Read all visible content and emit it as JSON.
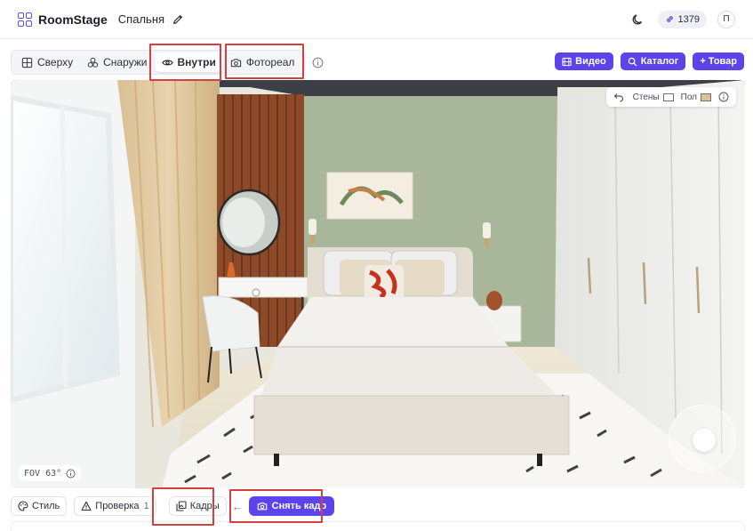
{
  "header": {
    "brand": "RoomStage",
    "room_name": "Спальня",
    "credits": "1379",
    "avatar_letter": "П"
  },
  "view_modes": {
    "tabs": [
      {
        "label": "Сверху",
        "icon": "grid-icon",
        "active": false
      },
      {
        "label": "Снаружи",
        "icon": "cubes-icon",
        "active": false
      },
      {
        "label": "Внутри",
        "icon": "eye-icon",
        "active": true
      },
      {
        "label": "Фотореал",
        "icon": "camera-icon",
        "active": false
      }
    ]
  },
  "actions": {
    "video_label": "Видео",
    "catalog_label": "Каталог",
    "product_label": "+ Товар"
  },
  "viewport": {
    "walls_label": "Стены",
    "floor_label": "Пол",
    "walls_color": "#ffffff",
    "floor_color": "#d9c39a",
    "fov_text": "FOV 63°"
  },
  "bottom": {
    "style_label": "Стиль",
    "check_label": "Проверка",
    "check_count": "1",
    "frames_label": "Кадры",
    "capture_label": "Снять кадр"
  },
  "colors": {
    "accent": "#5b44ea",
    "highlight": "#d44040",
    "wall_green": "#a8b79a",
    "wood": "#8c4a2a"
  }
}
